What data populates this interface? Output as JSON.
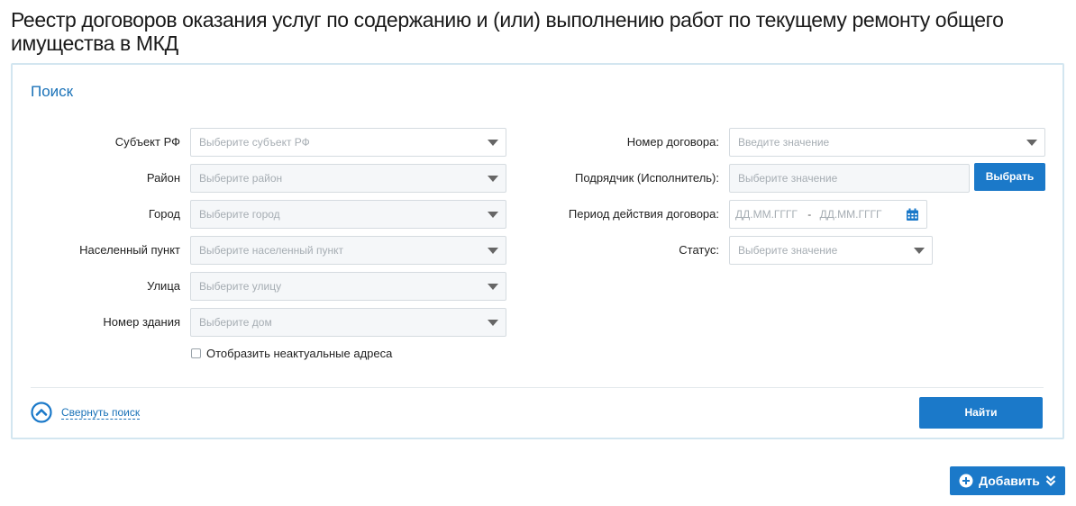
{
  "page": {
    "title": "Реестр договоров оказания услуг по содержанию и (или) выполнению работ по текущему ремонту общего имущества в МКД"
  },
  "search": {
    "title": "Поиск",
    "left_fields": [
      {
        "label": "Субъект РФ",
        "placeholder": "Выберите субъект РФ"
      },
      {
        "label": "Район",
        "placeholder": "Выберите район"
      },
      {
        "label": "Город",
        "placeholder": "Выберите город"
      },
      {
        "label": "Населенный пункт",
        "placeholder": "Выберите населенный пункт"
      },
      {
        "label": "Улица",
        "placeholder": "Выберите улицу"
      },
      {
        "label": "Номер здания",
        "placeholder": "Выберите дом"
      }
    ],
    "checkbox_label": "Отобразить неактуальные адреса",
    "checkbox_checked": false,
    "right_fields": {
      "contract_number": {
        "label": "Номер договора:",
        "placeholder": "Введите значение"
      },
      "contractor": {
        "label": "Подрядчик (Исполнитель):",
        "placeholder": "Выберите значение",
        "button": "Выбрать"
      },
      "period": {
        "label": "Период действия договора:",
        "from_placeholder": "ДД.ММ.ГГГГ",
        "separator": "-",
        "to_placeholder": "ДД.ММ.ГГГГ"
      },
      "status": {
        "label": "Статус:",
        "placeholder": "Выберите значение"
      }
    },
    "collapse_label": "Свернуть поиск",
    "find_button": "Найти"
  },
  "actions": {
    "add_button": "Добавить"
  },
  "colors": {
    "accent": "#1b79c9",
    "panel_border": "#d3e6f0",
    "link": "#1a72b8"
  },
  "icons": [
    "chevron-down-icon",
    "calendar-icon",
    "collapse-up-icon",
    "plus-circle-icon",
    "double-chevron-down-icon"
  ]
}
